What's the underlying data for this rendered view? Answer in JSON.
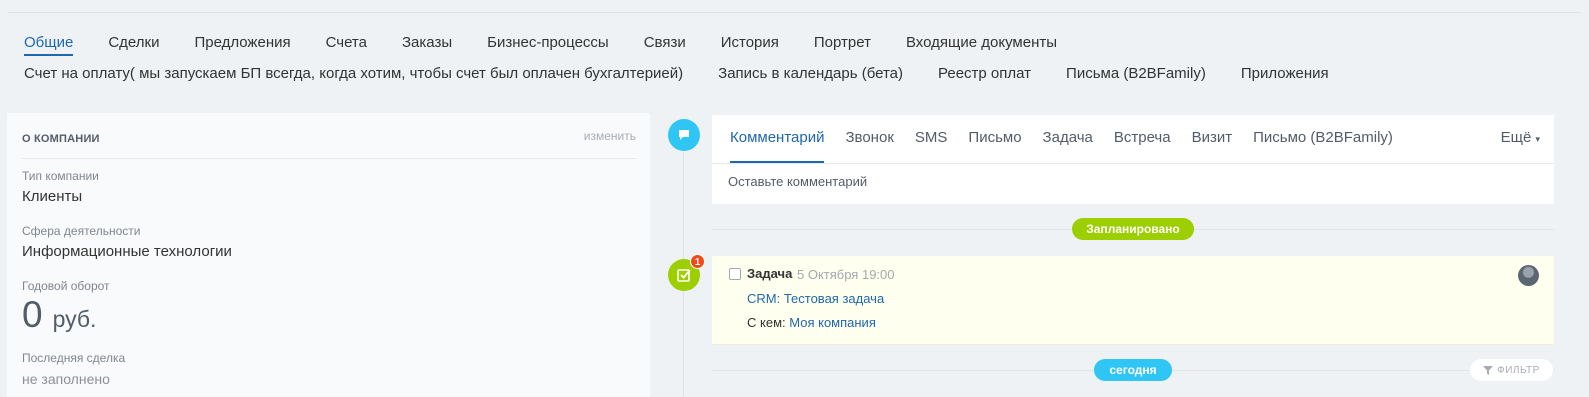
{
  "tabs_row1": [
    "Общие",
    "Сделки",
    "Предложения",
    "Счета",
    "Заказы",
    "Бизнес-процессы",
    "Связи",
    "История",
    "Портрет",
    "Входящие документы"
  ],
  "tabs_row2": [
    "Счет на оплату( мы запускаем БП всегда, когда хотим, чтобы счет был оплачен бухгалтерией)",
    "Запись в календарь (бета)",
    "Реестр оплат",
    "Письма (B2BFamily)",
    "Приложения"
  ],
  "company": {
    "title": "О КОМПАНИИ",
    "edit_label": "изменить",
    "type_label": "Тип компании",
    "type_value": "Клиенты",
    "industry_label": "Сфера деятельности",
    "industry_value": "Информационные технологии",
    "turnover_label": "Годовой оборот",
    "turnover_value": "0",
    "turnover_currency": "руб.",
    "last_deal_label": "Последняя сделка",
    "last_deal_value": "не заполнено"
  },
  "editor": {
    "tabs": [
      "Комментарий",
      "Звонок",
      "SMS",
      "Письмо",
      "Задача",
      "Встреча",
      "Визит",
      "Письмо (B2BFamily)"
    ],
    "more_label": "Ещё",
    "placeholder": "Оставьте комментарий"
  },
  "timeline": {
    "planned_label": "Запланировано",
    "today_label": "сегодня",
    "filter_label": "ФИЛЬТР",
    "task": {
      "badge": "1",
      "title": "Задача",
      "date": "5 Октября 19:00",
      "link": "CRM: Тестовая задача",
      "with_label": "С кем:",
      "with_value": "Моя компания"
    }
  },
  "colors": {
    "accent": "#2067b0",
    "green": "#9dcf00",
    "blue": "#2fc6f6",
    "badge_red": "#f54819"
  }
}
